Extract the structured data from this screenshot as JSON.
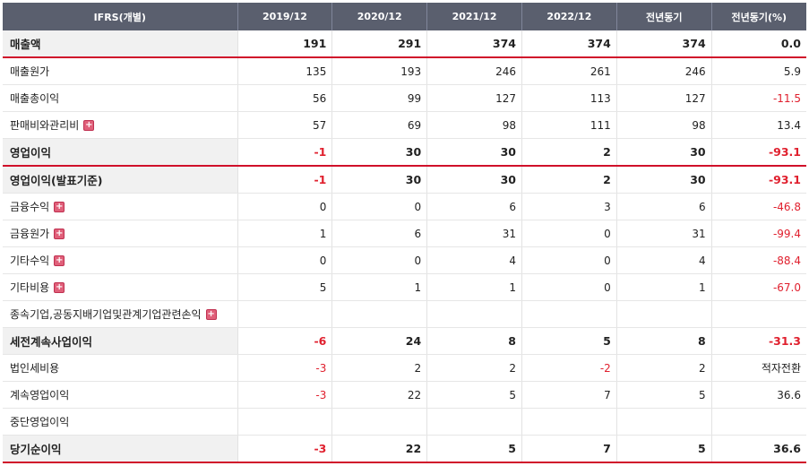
{
  "header": [
    "IFRS(개별)",
    "2019/12",
    "2020/12",
    "2021/12",
    "2022/12",
    "전년동기",
    "전년동기(%)"
  ],
  "rows": [
    {
      "label": "매출액",
      "values": [
        "191",
        "291",
        "374",
        "374",
        "374",
        "0.0"
      ],
      "bold": true,
      "expand": false,
      "shade": true,
      "botred": true,
      "neg": [
        false,
        false,
        false,
        false,
        false,
        false
      ]
    },
    {
      "label": "매출원가",
      "values": [
        "135",
        "193",
        "246",
        "261",
        "246",
        "5.9"
      ],
      "bold": false,
      "expand": false,
      "neg": [
        false,
        false,
        false,
        false,
        false,
        false
      ]
    },
    {
      "label": "매출총이익",
      "values": [
        "56",
        "99",
        "127",
        "113",
        "127",
        "-11.5"
      ],
      "bold": false,
      "expand": false,
      "neg": [
        false,
        false,
        false,
        false,
        false,
        true
      ]
    },
    {
      "label": "판매비와관리비",
      "values": [
        "57",
        "69",
        "98",
        "111",
        "98",
        "13.4"
      ],
      "bold": false,
      "expand": true,
      "neg": [
        false,
        false,
        false,
        false,
        false,
        false
      ]
    },
    {
      "label": "영업이익",
      "values": [
        "-1",
        "30",
        "30",
        "2",
        "30",
        "-93.1"
      ],
      "bold": true,
      "expand": false,
      "shade": true,
      "botred": true,
      "neg": [
        true,
        false,
        false,
        false,
        false,
        true
      ]
    },
    {
      "label": "영업이익(발표기준)",
      "values": [
        "-1",
        "30",
        "30",
        "2",
        "30",
        "-93.1"
      ],
      "bold": true,
      "expand": false,
      "shade": true,
      "neg": [
        true,
        false,
        false,
        false,
        false,
        true
      ]
    },
    {
      "label": "금융수익",
      "values": [
        "0",
        "0",
        "6",
        "3",
        "6",
        "-46.8"
      ],
      "bold": false,
      "expand": true,
      "neg": [
        false,
        false,
        false,
        false,
        false,
        true
      ]
    },
    {
      "label": "금융원가",
      "values": [
        "1",
        "6",
        "31",
        "0",
        "31",
        "-99.4"
      ],
      "bold": false,
      "expand": true,
      "neg": [
        false,
        false,
        false,
        false,
        false,
        true
      ]
    },
    {
      "label": "기타수익",
      "values": [
        "0",
        "0",
        "4",
        "0",
        "4",
        "-88.4"
      ],
      "bold": false,
      "expand": true,
      "neg": [
        false,
        false,
        false,
        false,
        false,
        true
      ]
    },
    {
      "label": "기타비용",
      "values": [
        "5",
        "1",
        "1",
        "0",
        "1",
        "-67.0"
      ],
      "bold": false,
      "expand": true,
      "neg": [
        false,
        false,
        false,
        false,
        false,
        true
      ]
    },
    {
      "label": "종속기업,공동지배기업및관계기업관련손익",
      "values": [
        "",
        "",
        "",
        "",
        "",
        ""
      ],
      "bold": false,
      "expand": true,
      "neg": [
        false,
        false,
        false,
        false,
        false,
        false
      ]
    },
    {
      "label": "세전계속사업이익",
      "values": [
        "-6",
        "24",
        "8",
        "5",
        "8",
        "-31.3"
      ],
      "bold": true,
      "expand": false,
      "shade": true,
      "neg": [
        true,
        false,
        false,
        false,
        false,
        true
      ]
    },
    {
      "label": "법인세비용",
      "values": [
        "-3",
        "2",
        "2",
        "-2",
        "2",
        "적자전환"
      ],
      "bold": false,
      "expand": false,
      "neg": [
        true,
        false,
        false,
        true,
        false,
        false
      ]
    },
    {
      "label": "계속영업이익",
      "values": [
        "-3",
        "22",
        "5",
        "7",
        "5",
        "36.6"
      ],
      "bold": false,
      "expand": false,
      "neg": [
        true,
        false,
        false,
        false,
        false,
        false
      ]
    },
    {
      "label": "중단영업이익",
      "values": [
        "",
        "",
        "",
        "",
        "",
        ""
      ],
      "bold": false,
      "expand": false,
      "neg": [
        false,
        false,
        false,
        false,
        false,
        false
      ]
    },
    {
      "label": "당기순이익",
      "values": [
        "-3",
        "22",
        "5",
        "7",
        "5",
        "36.6"
      ],
      "bold": true,
      "expand": false,
      "shade": true,
      "botred": true,
      "neg": [
        true,
        false,
        false,
        false,
        false,
        false
      ]
    }
  ],
  "colors": {
    "header_bg": "#5a5f6e",
    "accent_red": "#d0102a",
    "negative": "#e0202e"
  },
  "icons": {
    "expand": "plus-square-icon"
  }
}
